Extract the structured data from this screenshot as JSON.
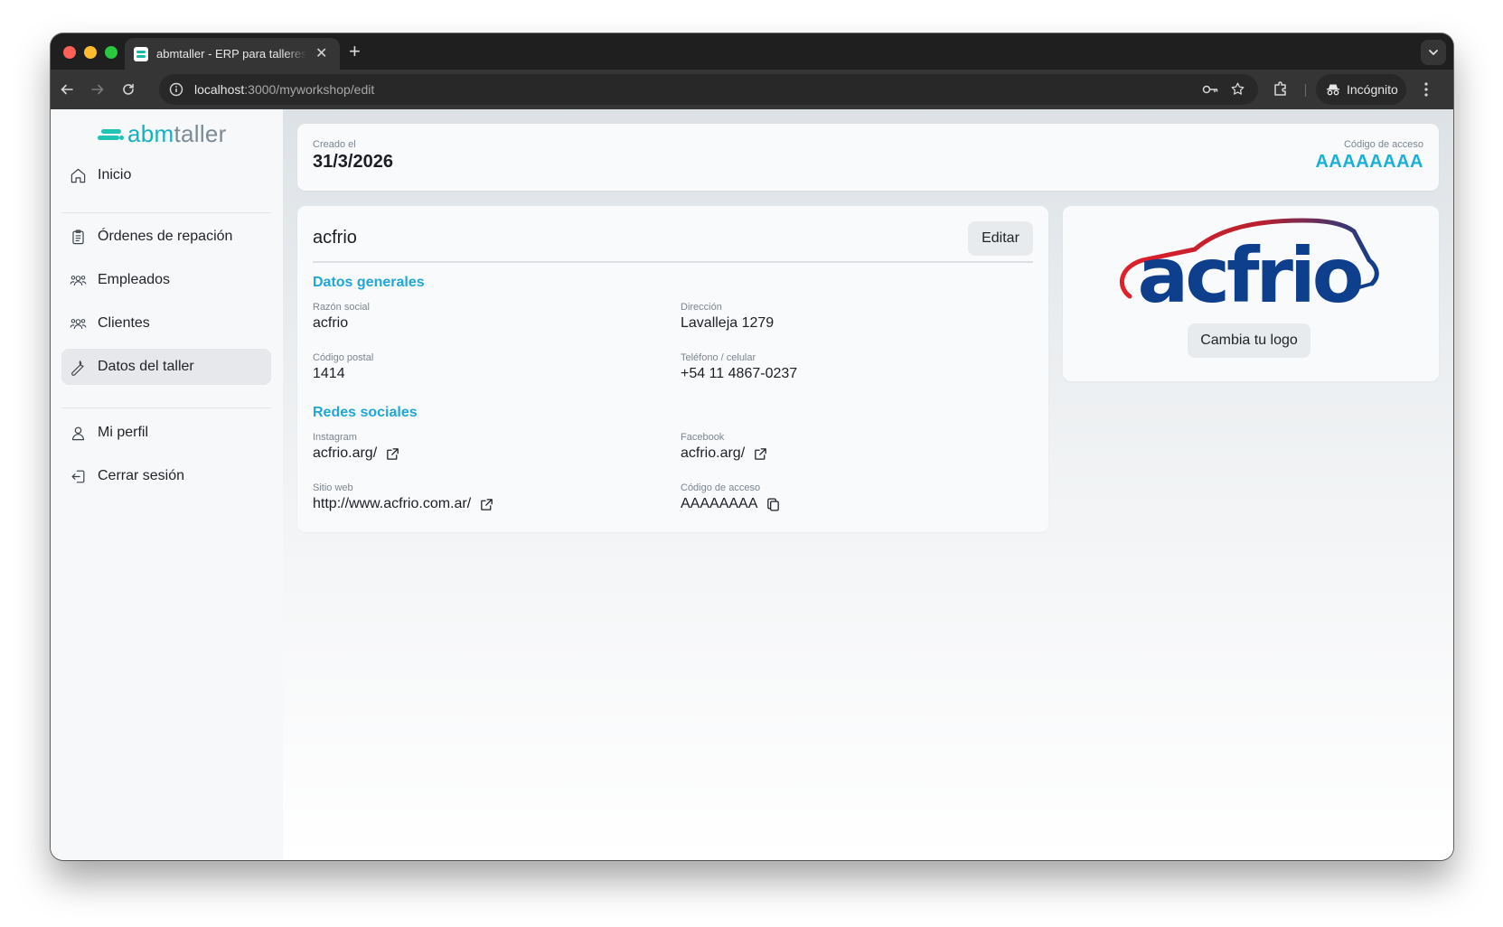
{
  "browser": {
    "tab_title": "abmtaller - ERP para talleres mecánicos",
    "url_host": "localhost",
    "url_path": ":3000/myworkshop/edit",
    "incognito_label": "Incógnito"
  },
  "sidebar": {
    "logo": {
      "part1": "abm",
      "part2": "taller"
    },
    "items": [
      {
        "label": "Inicio",
        "icon": "home-icon"
      },
      {
        "label": "Órdenes de repación",
        "icon": "clipboard-icon"
      },
      {
        "label": "Empleados",
        "icon": "users-icon"
      },
      {
        "label": "Clientes",
        "icon": "users-icon"
      },
      {
        "label": "Datos del taller",
        "icon": "wrench-icon",
        "active": true
      },
      {
        "label": "Mi perfil",
        "icon": "user-icon"
      },
      {
        "label": "Cerrar sesión",
        "icon": "logout-icon"
      }
    ]
  },
  "header_card": {
    "created_label": "Creado el",
    "created_value": "31/3/2026",
    "access_label": "Código de acceso",
    "access_value": "AAAAAAAA"
  },
  "details": {
    "name": "acfrio",
    "edit_label": "Editar",
    "general_title": "Datos generales",
    "razon_label": "Razón social",
    "razon_value": "acfrio",
    "direccion_label": "Dirección",
    "direccion_value": "Lavalleja 1279",
    "cp_label": "Código postal",
    "cp_value": "1414",
    "tel_label": "Teléfono / celular",
    "tel_value": "+54 11 4867-0237",
    "social_title": "Redes sociales",
    "instagram_label": "Instagram",
    "instagram_value": "acfrio.arg/",
    "facebook_label": "Facebook",
    "facebook_value": "acfrio.arg/",
    "web_label": "Sitio web",
    "web_value": "http://www.acfrio.com.ar/",
    "code_label": "Código de acceso",
    "code_value": "AAAAAAAA"
  },
  "logo_card": {
    "logo_text": "acfrio",
    "change_label": "Cambia tu logo"
  },
  "colors": {
    "accent": "#1ab0d8",
    "brand_teal": "#1fc4b4",
    "acfrio_blue": "#0e3f8c",
    "acfrio_red": "#e0202a"
  }
}
